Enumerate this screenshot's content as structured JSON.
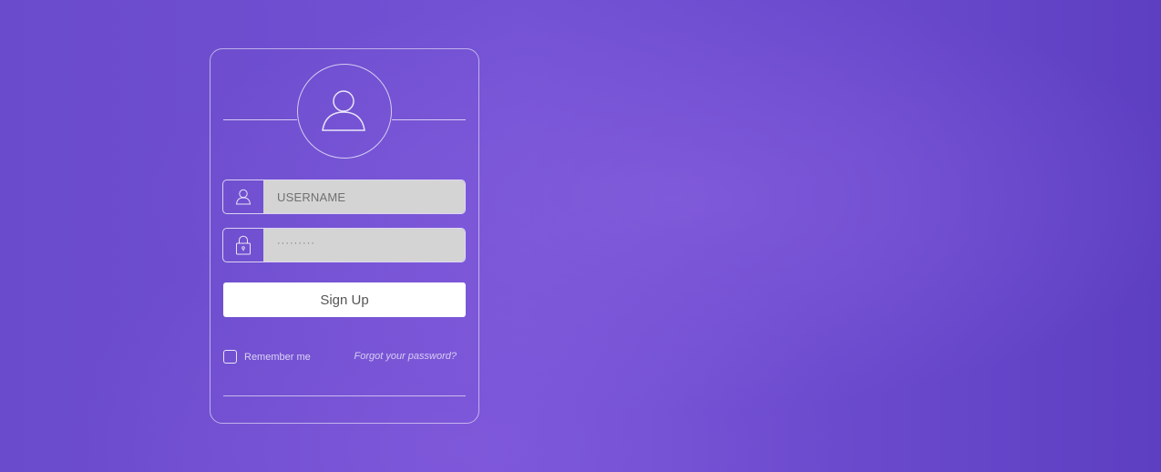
{
  "login_form": {
    "username": {
      "placeholder": "USERNAME",
      "icon": "user-icon"
    },
    "password": {
      "masked_value": "·········",
      "icon": "lock-icon"
    },
    "signup_label": "Sign Up",
    "remember_me_label": "Remember me",
    "remember_me_checked": false,
    "forgot_password_label": "Forgot your password?",
    "avatar_icon": "user-avatar-icon"
  },
  "colors": {
    "background": "#6a4bcb",
    "field_fill": "#d4d4d4",
    "button_fill": "#ffffff",
    "outline": "#ffffff"
  }
}
